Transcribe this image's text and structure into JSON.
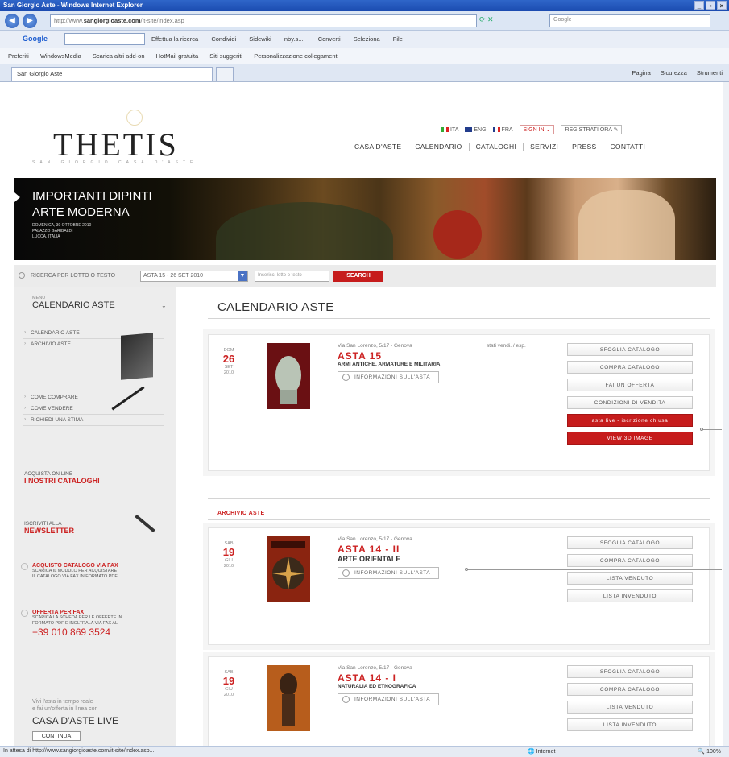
{
  "browser": {
    "title": "San Giorgio Aste - Windows Internet Explorer",
    "url_prefix": "http://www.",
    "url_domain": "sangiorgioaste.com",
    "url_path": "/it-site/index.asp",
    "search_engine": "Google",
    "google_label": "Google",
    "toolbar_items": [
      "Effettua la ricerca",
      "Condividi",
      "Sidewiki",
      "nby.s....",
      "Converti",
      "Seleziona",
      "File"
    ],
    "favorites_items": [
      "Preferiti",
      "WindowsMedia",
      "Scarica altri add-on",
      "HotMail gratuita",
      "Siti suggeriti",
      "Personalizzazione collegamenti"
    ],
    "tab_label": "San Giorgio Aste",
    "cmd_items": [
      "Pagina",
      "Sicurezza",
      "Strumenti"
    ],
    "status_text": "In attesa di http://www.sangiorgioaste.com/it-site/index.asp...",
    "zone": "Internet",
    "zoom": "100%"
  },
  "site": {
    "logo": "THETIS",
    "logo_sub": "SAN GIORGIO CASA D'ASTE",
    "languages": [
      {
        "code": "ITA",
        "flag": "it"
      },
      {
        "code": "ENG",
        "flag": "en"
      },
      {
        "code": "FRA",
        "flag": "fr"
      }
    ],
    "sign_in": "SIGN IN",
    "register": "REGISTRATI ORA",
    "nav": [
      "CASA D'ASTE",
      "CALENDARIO",
      "CATALOGHI",
      "SERVIZI",
      "PRESS",
      "CONTATTI"
    ]
  },
  "banner": {
    "line1": "IMPORTANTI DIPINTI",
    "line2": "ARTE MODERNA",
    "details": [
      "DOMENICA, 30 OTTOBRE 2010",
      "PALAZZO GARIBALDI",
      "LUCCA, ITALIA"
    ]
  },
  "search": {
    "label": "RICERCA PER LOTTO O TESTO",
    "selected": "ASTA 15 - 26 SET 2010",
    "placeholder": "Inserisci lotto o testo",
    "button": "SEARCH"
  },
  "sidebar": {
    "menu_small": "MENU",
    "menu_title": "CALENDARIO ASTE",
    "links_top": [
      "CALENDARIO ASTE",
      "ARCHIVIO ASTE"
    ],
    "links_mid": [
      "COME COMPRARE",
      "COME VENDERE",
      "RICHIEDI UNA STIMA"
    ],
    "catalog_line1": "ACQUISTA ON LINE",
    "catalog_line2": "I NOSTRI CATALOGHI",
    "newsletter_line1": "ISCRIVITI ALLA",
    "newsletter_line2": "NEWSLETTER",
    "fax_title": "ACQUISTO CATALOGO VIA FAX",
    "fax_desc": "SCARICA IL MODULO PER ACQUISTARE IL CATALOGO VIA FAX IN FORMATO PDF",
    "offer_title": "OFFERTA PER FAX",
    "offer_desc": "SCARICA LA SCHEDA PER LE OFFERTE IN FORMATO PDF E INOLTRALA VIA FAX AL",
    "phone": "+39 010 869 3524",
    "live_sub1": "Vivi l'asta in tempo reale",
    "live_sub2": "e fai un'offerta in linea con",
    "live_title": "CASA D'ASTE LIVE",
    "live_btn": "CONTINUA"
  },
  "main": {
    "title": "CALENDARIO ASTE",
    "archive_title": "ARCHIVIO ASTE",
    "current": {
      "weekday": "DOM",
      "day": "26",
      "month": "SET",
      "year": "2010",
      "location": "Via San Lorenzo, 5/17 - Genova",
      "name": "ASTA 15",
      "subject": "ARMI ANTICHE, ARMATURE E MILITARIA",
      "info": "INFORMAZIONI SULL'ASTA",
      "status": "stati vendi. / esp.",
      "actions": [
        "SFOGLIA CATALOGO",
        "COMPRA CATALOGO",
        "FAI UN OFFERTA",
        "CONDIZIONI DI VENDITA"
      ],
      "red_actions": [
        "asta live - iscrizione chiusa",
        "VIEW 3D IMAGE"
      ]
    },
    "archive": [
      {
        "weekday": "SAB",
        "day": "19",
        "month": "GIU",
        "year": "2010",
        "location": "Via San Lorenzo, 5/17 - Genova",
        "name": "ASTA 14 - II",
        "subject": "ARTE ORIENTALE",
        "info": "INFORMAZIONI SULL'ASTA",
        "actions": [
          "SFOGLIA CATALOGO",
          "COMPRA CATALOGO",
          "LISTA VENDUTO",
          "LISTA INVENDUTO"
        ]
      },
      {
        "weekday": "SAB",
        "day": "19",
        "month": "GIU",
        "year": "2010",
        "location": "Via San Lorenzo, 5/17 - Genova",
        "name": "ASTA 14 - I",
        "subject": "NATURALIA ED ETNOGRAFICA",
        "info": "INFORMAZIONI SULL'ASTA",
        "actions": [
          "SFOGLIA CATALOGO",
          "COMPRA CATALOGO",
          "LISTA VENDUTO",
          "LISTA INVENDUTO"
        ]
      }
    ]
  },
  "colors": {
    "accent_red": "#c61c1c",
    "sidebar_bg": "#ededed",
    "ie_blue": "#2f66c9"
  }
}
